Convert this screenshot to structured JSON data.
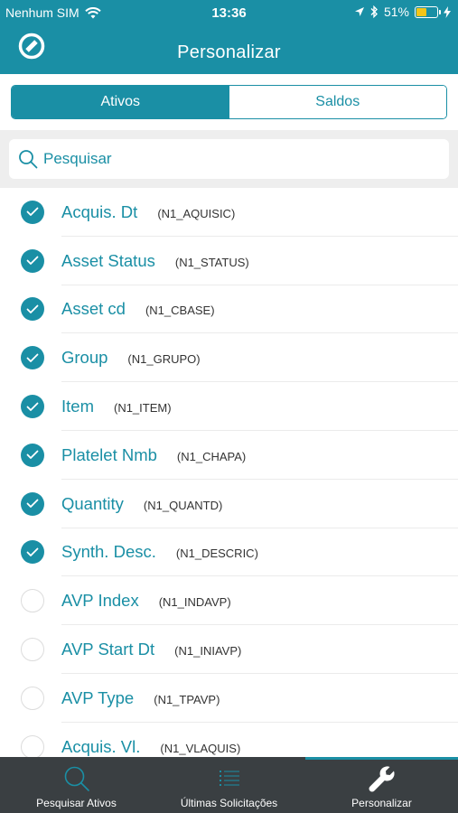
{
  "status_bar": {
    "carrier": "Nenhum SIM",
    "time": "13:36",
    "battery": "51%",
    "battery_level": 0.51
  },
  "header": {
    "title": "Personalizar"
  },
  "segments": {
    "ativos": "Ativos",
    "saldos": "Saldos",
    "selected": "Ativos"
  },
  "search": {
    "placeholder": "Pesquisar"
  },
  "items": [
    {
      "label": "Acquis. Dt",
      "code": "(N1_AQUISIC)",
      "checked": true
    },
    {
      "label": "Asset Status",
      "code": "(N1_STATUS)",
      "checked": true
    },
    {
      "label": "Asset cd",
      "code": "(N1_CBASE)",
      "checked": true
    },
    {
      "label": "Group",
      "code": "(N1_GRUPO)",
      "checked": true
    },
    {
      "label": "Item",
      "code": "(N1_ITEM)",
      "checked": true
    },
    {
      "label": "Platelet Nmb",
      "code": "(N1_CHAPA)",
      "checked": true
    },
    {
      "label": "Quantity",
      "code": "(N1_QUANTD)",
      "checked": true
    },
    {
      "label": "Synth. Desc.",
      "code": "(N1_DESCRIC)",
      "checked": true
    },
    {
      "label": "AVP Index",
      "code": "(N1_INDAVP)",
      "checked": false
    },
    {
      "label": "AVP Start Dt",
      "code": "(N1_INIAVP)",
      "checked": false
    },
    {
      "label": "AVP Type",
      "code": "(N1_TPAVP)",
      "checked": false
    },
    {
      "label": "Acquis. Vl.",
      "code": "(N1_VLAQUIS)",
      "checked": false
    }
  ],
  "tabbar": {
    "tabs": [
      {
        "label": "Pesquisar Ativos",
        "icon": "search-icon"
      },
      {
        "label": "Últimas Solicitações",
        "icon": "list-icon"
      },
      {
        "label": "Personalizar",
        "icon": "wrench-icon"
      }
    ],
    "active": "Personalizar"
  },
  "colors": {
    "accent": "#1a8fa5",
    "tabbar_bg": "#3a3f42",
    "battery": "#f5c518"
  }
}
